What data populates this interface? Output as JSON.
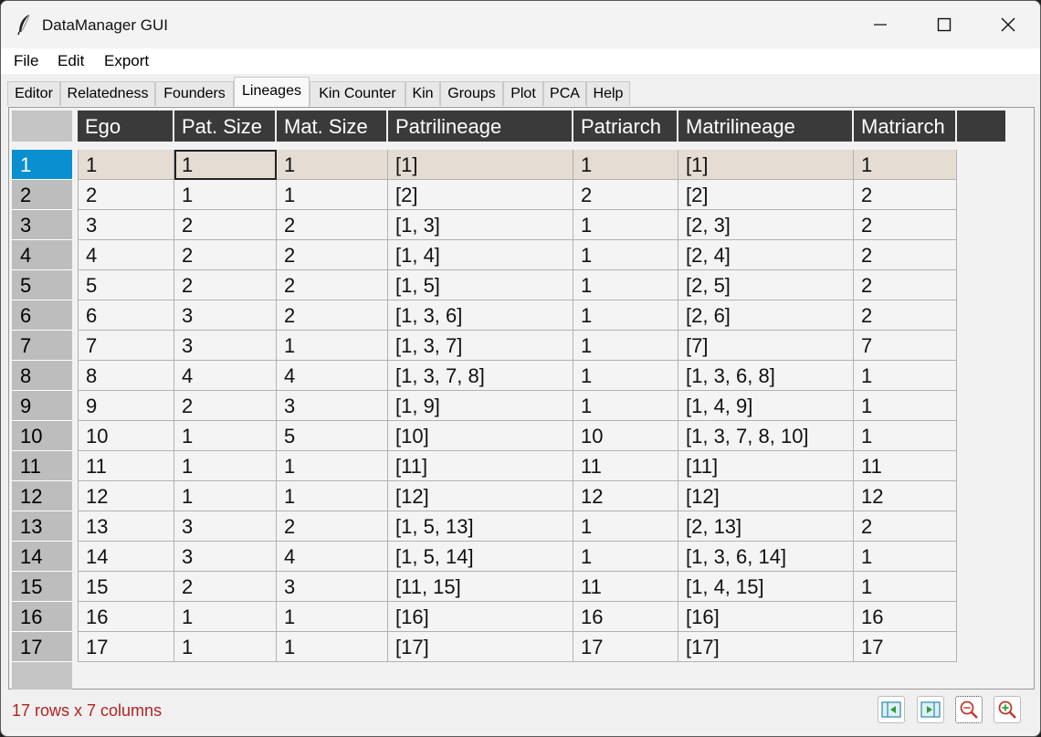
{
  "window": {
    "title": "DataManager GUI",
    "controls": {
      "minimize_icon": "minimize-icon",
      "maximize_icon": "maximize-icon",
      "close_icon": "close-icon"
    }
  },
  "menu": {
    "items": [
      "File",
      "Edit",
      "Export"
    ]
  },
  "tabs": {
    "items": [
      "Editor",
      "Relatedness",
      "Founders",
      "Lineages",
      "Kin Counter",
      "Kin",
      "Groups",
      "Plot",
      "PCA",
      "Help"
    ],
    "active": "Lineages"
  },
  "table": {
    "columns": [
      "Ego",
      "Pat. Size",
      "Mat. Size",
      "Patrilineage",
      "Patriarch",
      "Matrilineage",
      "Matriarch"
    ],
    "row_headers": [
      "1",
      "2",
      "3",
      "4",
      "5",
      "6",
      "7",
      "8",
      "9",
      "10",
      "11",
      "12",
      "13",
      "14",
      "15",
      "16",
      "17"
    ],
    "rows": [
      [
        "1",
        "1",
        "1",
        "[1]",
        "1",
        "[1]",
        "1"
      ],
      [
        "2",
        "1",
        "1",
        "[2]",
        "2",
        "[2]",
        "2"
      ],
      [
        "3",
        "2",
        "2",
        "[1, 3]",
        "1",
        "[2, 3]",
        "2"
      ],
      [
        "4",
        "2",
        "2",
        "[1, 4]",
        "1",
        "[2, 4]",
        "2"
      ],
      [
        "5",
        "2",
        "2",
        "[1, 5]",
        "1",
        "[2, 5]",
        "2"
      ],
      [
        "6",
        "3",
        "2",
        "[1, 3, 6]",
        "1",
        "[2, 6]",
        "2"
      ],
      [
        "7",
        "3",
        "1",
        "[1, 3, 7]",
        "1",
        "[7]",
        "7"
      ],
      [
        "8",
        "4",
        "4",
        "[1, 3, 7, 8]",
        "1",
        "[1, 3, 6, 8]",
        "1"
      ],
      [
        "9",
        "2",
        "3",
        "[1, 9]",
        "1",
        "[1, 4, 9]",
        "1"
      ],
      [
        "10",
        "1",
        "5",
        "[10]",
        "10",
        "[1, 3, 7, 8, 10]",
        "1"
      ],
      [
        "11",
        "1",
        "1",
        "[11]",
        "11",
        "[11]",
        "11"
      ],
      [
        "12",
        "1",
        "1",
        "[12]",
        "12",
        "[12]",
        "12"
      ],
      [
        "13",
        "3",
        "2",
        "[1, 5, 13]",
        "1",
        "[2, 13]",
        "2"
      ],
      [
        "14",
        "3",
        "4",
        "[1, 5, 14]",
        "1",
        "[1, 3, 6, 14]",
        "1"
      ],
      [
        "15",
        "2",
        "3",
        "[11, 15]",
        "11",
        "[1, 4, 15]",
        "1"
      ],
      [
        "16",
        "1",
        "1",
        "[16]",
        "16",
        "[16]",
        "16"
      ],
      [
        "17",
        "1",
        "1",
        "[17]",
        "17",
        "[17]",
        "17"
      ]
    ],
    "selected_row": 1
  },
  "status": {
    "text": "17 rows x 7 columns"
  },
  "colors": {
    "selected_row_header": "#0a8fd0",
    "highlight_row": "#e5ddd4",
    "header_bg": "#3a3a3a",
    "status_text": "#b22222"
  },
  "toolbar": {
    "icons": [
      "prev-page-icon",
      "next-page-icon",
      "zoom-out-icon",
      "zoom-in-icon"
    ]
  }
}
